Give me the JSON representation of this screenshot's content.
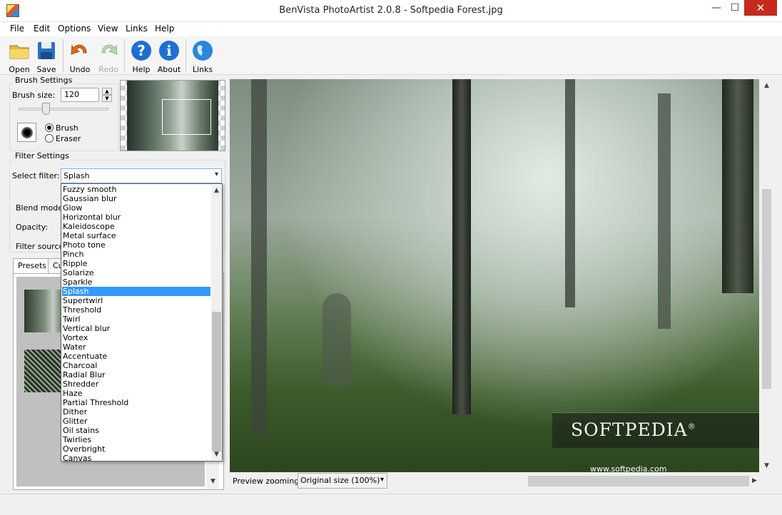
{
  "window": {
    "title": "BenVista PhotoArtist 2.0.8 - Softpedia Forest.jpg",
    "minimize": "—",
    "maximize": "☐",
    "close": "✕"
  },
  "menu": [
    "File",
    "Edit",
    "Options",
    "View",
    "Links",
    "Help"
  ],
  "toolbar": {
    "open": "Open",
    "save": "Save",
    "undo": "Undo",
    "redo": "Redo",
    "help": "Help",
    "about": "About",
    "links": "Links"
  },
  "brush_settings": {
    "title": "Brush Settings",
    "size_label": "Brush size:",
    "size_value": "120",
    "mode_brush": "Brush",
    "mode_eraser": "Eraser",
    "mode_selected": "Brush"
  },
  "filter_settings": {
    "title": "Filter Settings",
    "select_label": "Select filter:",
    "selected": "Splash",
    "blend_label": "Blend mode:",
    "opacity_label": "Opacity:",
    "source_label": "Filter source:",
    "tabs": [
      "Presets",
      "Cu"
    ],
    "options": [
      "Fuzzy smooth",
      "Gaussian blur",
      "Glow",
      "Horizontal blur",
      "Kaleidoscope",
      "Metal surface",
      "Photo tone",
      "Pinch",
      "Ripple",
      "Solarize",
      "Sparkle",
      "Splash",
      "Supertwirl",
      "Threshold",
      "Twirl",
      "Vertical blur",
      "Vortex",
      "Water",
      "Accentuate",
      "Charcoal",
      "Radial Blur",
      "Shredder",
      "Haze",
      "Partial Threshold",
      "Dither",
      "Glitter",
      "Oil stains",
      "Twirlies",
      "Overbright",
      "Canvas"
    ]
  },
  "canvas": {
    "logo": "SOFTPEDIA",
    "logo_mark": "®",
    "url": "www.softpedia.com"
  },
  "preview": {
    "zoom_label": "Preview zooming:",
    "zoom_value": "Original size (100%)"
  }
}
